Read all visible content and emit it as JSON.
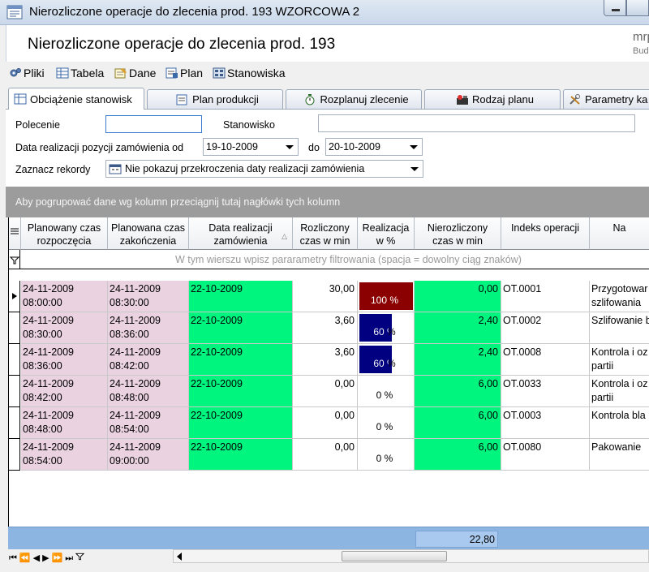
{
  "window": {
    "title": "Nierozliczone operacje do zlecenia prod. 193 WZORCOWA 2"
  },
  "header": {
    "heading": "Nierozliczone operacje do zlecenia prod. 193",
    "brand": "mrp",
    "brand_sub": "Bud"
  },
  "menu": {
    "items": [
      {
        "label": "Pliki",
        "icon": "gears-icon"
      },
      {
        "label": "Tabela",
        "icon": "table-icon"
      },
      {
        "label": "Dane",
        "icon": "data-icon"
      },
      {
        "label": "Plan",
        "icon": "plan-icon"
      },
      {
        "label": "Stanowiska",
        "icon": "workstation-icon"
      }
    ]
  },
  "tabs": [
    {
      "label": "Obciążenie stanowisk",
      "active": true
    },
    {
      "label": "Plan produkcji",
      "active": false
    },
    {
      "label": "Rozplanuj zlecenie",
      "active": false
    },
    {
      "label": "Rodzaj planu",
      "active": false
    },
    {
      "label": "Parametry ka",
      "active": false
    }
  ],
  "filters": {
    "polecenie_label": "Polecenie",
    "polecenie_value": "",
    "stanowisko_label": "Stanowisko",
    "stanowisko_value": "",
    "date_label": "Data realizacji pozycji zamówienia od",
    "date_from": "19-10-2009",
    "date_to_label": "do",
    "date_to": "20-10-2009",
    "mark_label": "Zaznacz rekordy",
    "mark_value": "Nie pokazuj przekroczenia daty realizacji zamówienia"
  },
  "grid": {
    "group_hint": "Aby pogrupować dane wg kolumn przeciągnij tutaj nagłówki tych kolumn",
    "filter_hint": "W tym wierszu wpisz pararametry filtrowania (spacja = dowolny ciąg znaków)",
    "columns": [
      "Planowany czas rozpoczęcia",
      "Planowana czas zakończenia",
      "Data realizacji zamówienia",
      "Rozliczony czas w min",
      "Realizacja w %",
      "Nierozliczony czas w min",
      "Indeks operacji",
      "Na"
    ],
    "rows": [
      {
        "start_date": "24-11-2009",
        "start_time": "08:00:00",
        "end_date": "24-11-2009",
        "end_time": "08:30:00",
        "order_date": "22-10-2009",
        "settled": "30,00",
        "realization": 100,
        "realization_label": "100 %",
        "unsettled": "0,00",
        "op_index": "OT.0001",
        "name_l1": "Przygotowar",
        "name_l2": "szlifowania",
        "current": true
      },
      {
        "start_date": "24-11-2009",
        "start_time": "08:30:00",
        "end_date": "24-11-2009",
        "end_time": "08:36:00",
        "order_date": "22-10-2009",
        "settled": "3,60",
        "realization": 60,
        "realization_label": "60 %",
        "unsettled": "2,40",
        "op_index": "OT.0002",
        "name_l1": "Szlifowanie b",
        "name_l2": "",
        "current": false
      },
      {
        "start_date": "24-11-2009",
        "start_time": "08:36:00",
        "end_date": "24-11-2009",
        "end_time": "08:42:00",
        "order_date": "22-10-2009",
        "settled": "3,60",
        "realization": 60,
        "realization_label": "60 %",
        "unsettled": "2,40",
        "op_index": "OT.0008",
        "name_l1": "Kontrola i oz",
        "name_l2": "partii",
        "current": false
      },
      {
        "start_date": "24-11-2009",
        "start_time": "08:42:00",
        "end_date": "24-11-2009",
        "end_time": "08:48:00",
        "order_date": "22-10-2009",
        "settled": "0,00",
        "realization": 0,
        "realization_label": "0 %",
        "unsettled": "6,00",
        "op_index": "OT.0033",
        "name_l1": "Kontrola i oz",
        "name_l2": "partii",
        "current": false
      },
      {
        "start_date": "24-11-2009",
        "start_time": "08:48:00",
        "end_date": "24-11-2009",
        "end_time": "08:54:00",
        "order_date": "22-10-2009",
        "settled": "0,00",
        "realization": 0,
        "realization_label": "0 %",
        "unsettled": "6,00",
        "op_index": "OT.0003",
        "name_l1": "Kontrola bla",
        "name_l2": "",
        "current": false
      },
      {
        "start_date": "24-11-2009",
        "start_time": "08:54:00",
        "end_date": "24-11-2009",
        "end_time": "09:00:00",
        "order_date": "22-10-2009",
        "settled": "0,00",
        "realization": 0,
        "realization_label": "0 %",
        "unsettled": "6,00",
        "op_index": "OT.0080",
        "name_l1": "Pakowanie",
        "name_l2": "",
        "current": false
      }
    ],
    "total_unsettled": "22,80"
  },
  "colors": {
    "pink": "#ead2e0",
    "green": "#00f57f",
    "bar_full": "#8b0000",
    "bar_partial": "#000080",
    "summary": "#8db5e2"
  }
}
